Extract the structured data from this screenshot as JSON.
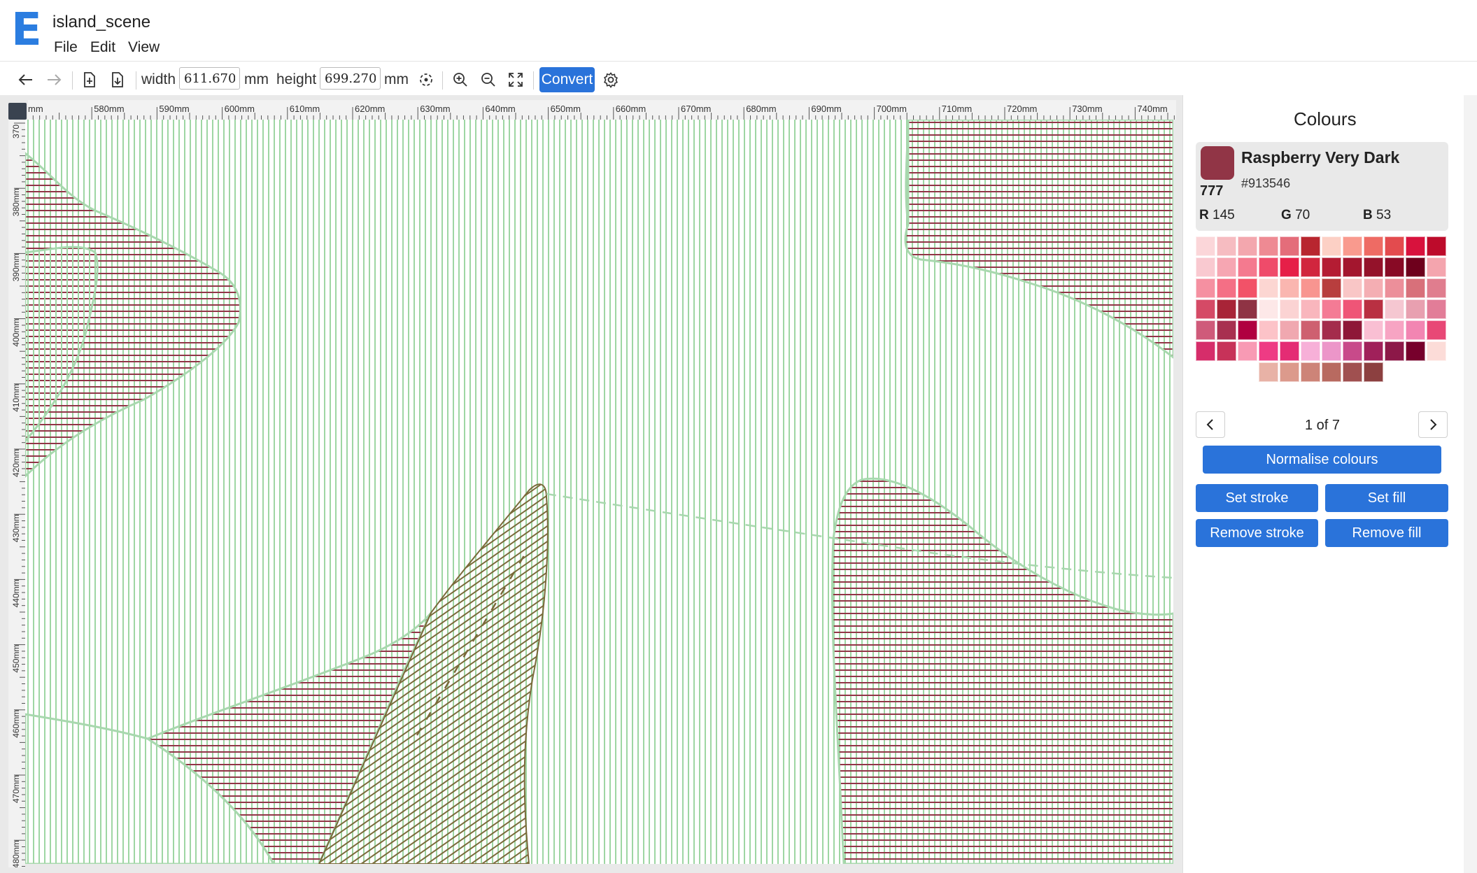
{
  "app": {
    "logo_letter": "E",
    "document_title": "island_scene"
  },
  "menu": [
    {
      "label": "File"
    },
    {
      "label": "Edit"
    },
    {
      "label": "View"
    }
  ],
  "toolbar": {
    "icons": [
      "back-arrow-icon",
      "forward-arrow-icon",
      "import-file-icon",
      "export-file-icon",
      "recenter-icon",
      "zoom-in-icon",
      "zoom-out-icon",
      "fit-screen-icon",
      "settings-gear-icon"
    ],
    "width_label": "width",
    "width_value": "611.670",
    "width_unit": "mm",
    "height_label": "height",
    "height_value": "699.270",
    "height_unit": "mm",
    "convert_label": "Convert"
  },
  "ruler": {
    "top_labels": [
      "mm",
      "580mm",
      "590mm",
      "600mm",
      "610mm",
      "620mm",
      "630mm",
      "640mm",
      "650mm",
      "660mm",
      "670mm",
      "680mm",
      "690mm",
      "700mm",
      "710mm",
      "720mm",
      "730mm",
      "740mm"
    ],
    "left_labels": [
      "370",
      "380mm",
      "390mm",
      "400mm",
      "410mm",
      "420mm",
      "430mm",
      "440mm",
      "450mm",
      "460mm",
      "470mm",
      "480mm"
    ]
  },
  "canvas_colors": {
    "green_hatch": "#9ed6a3",
    "green_outline": "#a8d8ae",
    "raspberry_hatch": "#913546",
    "olive_hatch": "#7a6a3a"
  },
  "colours_panel": {
    "title": "Colours",
    "selected": {
      "name": "Raspberry Very Dark",
      "hex": "#913546",
      "number": "777",
      "r_label": "R",
      "r": "145",
      "g_label": "G",
      "g": "70",
      "b_label": "B",
      "b": "53"
    },
    "palette": [
      [
        "#fbd6d9",
        "#f6bcc1",
        "#f3a7ae",
        "#ee8a93",
        "#e46d7a",
        "#b8262f",
        "#fcd0c5",
        "#f99a8e",
        "#ee6b64",
        "#e34b4e",
        "#d8123d",
        "#bd0b2b"
      ],
      [
        "#f9c9d0",
        "#f6a6b2",
        "#f47a8f",
        "#ef4b6a",
        "#e61f48",
        "#d1263e",
        "#b41c33",
        "#a3162e",
        "#94122a",
        "#880a25",
        "#6e001c",
        "#f4a5ae"
      ],
      [
        "#f590a1",
        "#f46f85",
        "#f25268",
        "#fcd6d2",
        "#fab6b0",
        "#f89590",
        "#b83e3e",
        "#f9c6c6",
        "#f4aeb3",
        "#ec8f9a",
        "#d8707a",
        "#e07d8e"
      ],
      [
        "#d54a66",
        "#a82437",
        "#8f3344",
        "#fde8e8",
        "#fbd3d3",
        "#f9b6bd",
        "#f47b95",
        "#ef5577",
        "#b93042",
        "#f5c7d1",
        "#e8a0b0",
        "#e27d98"
      ],
      [
        "#cf5a7a",
        "#a83050",
        "#b00040",
        "#fcc3c8",
        "#f0a8b0",
        "#ce6070",
        "#a42c4c",
        "#8e1838",
        "#f9bfd3",
        "#f7a4c3",
        "#f285b2",
        "#e84876"
      ],
      [
        "#d62d6a",
        "#c73259",
        "#f89ab4",
        "#ee3b84",
        "#e42c74",
        "#f7b0d8",
        "#ec96c9",
        "#c84a8a",
        "#a0205a",
        "#8c1848",
        "#77002c",
        "#fcdcd8"
      ],
      [
        null,
        null,
        null,
        "#e8b2a6",
        "#dc9a8c",
        "#cd8478",
        "#b86a60",
        "#a05050",
        "#8c4040",
        null,
        null,
        null
      ]
    ],
    "page_indicator": "1 of 7",
    "buttons": {
      "normalise": "Normalise colours",
      "set_stroke": "Set stroke",
      "set_fill": "Set fill",
      "remove_stroke": "Remove stroke",
      "remove_fill": "Remove fill"
    }
  }
}
